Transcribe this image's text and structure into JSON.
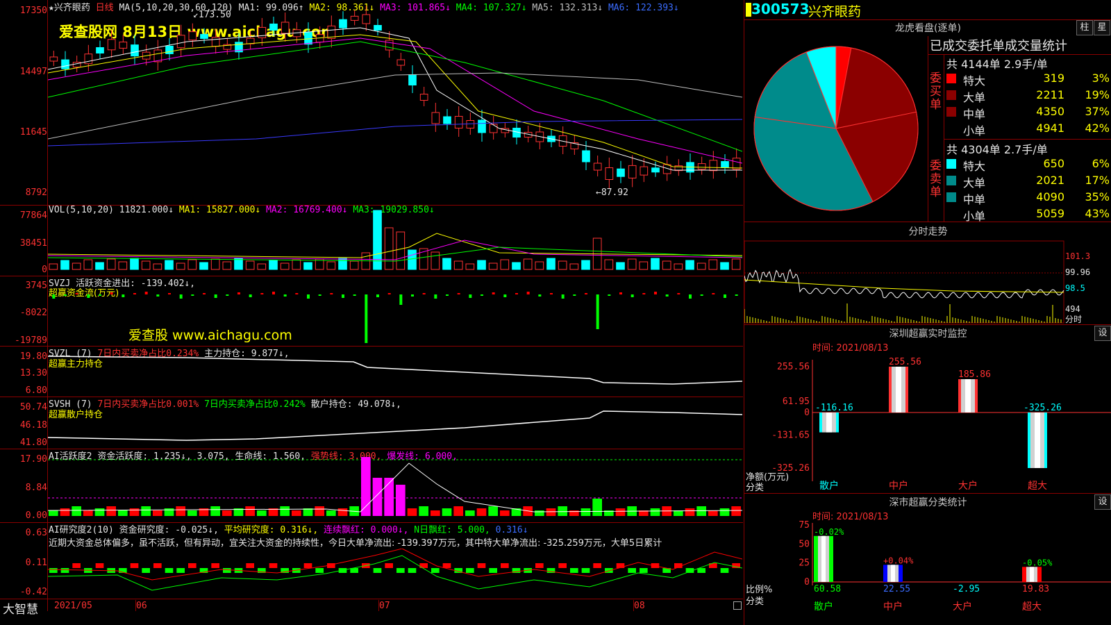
{
  "main_chart": {
    "title_star": "★",
    "stock_name": "兴齐眼药",
    "period": "日线",
    "ma_label": "MA(5,10,20,30,60,120)",
    "ma1": "MA1: 99.096↑",
    "ma2": "MA2: 98.361↓",
    "ma3": "MA3: 101.865↓",
    "ma4": "MA4: 107.327↓",
    "ma5": "MA5: 132.313↓",
    "ma6": "MA6: 122.393↓",
    "y_ticks": [
      "17350",
      "14497",
      "11645",
      "8792"
    ],
    "high_label": "173.50",
    "low_label": "87.92",
    "watermark": "爱查股网  8月13日 www.aichagu.com"
  },
  "vol_panel": {
    "title": "VOL(5,10,20)",
    "vol": "11821.000↓",
    "ma1": "MA1: 15827.000↓",
    "ma2": "MA2: 16769.400↓",
    "ma3": "MA3: 19029.850↓",
    "y_ticks": [
      "77864",
      "38451",
      "0"
    ]
  },
  "svzj_panel": {
    "title": "SVZJ",
    "value": "活跃资金进出: -139.402↓,",
    "subtitle": "超赢资金流(万元)",
    "y_ticks": [
      "3745",
      "-8022",
      "-19789"
    ],
    "watermark": "爱查股 www.aichagu.com"
  },
  "svzl_panel": {
    "title": "SVZL (7)",
    "ratio": "7日内买卖净占比0.234%",
    "value": "主力持仓: 9.877↓,",
    "subtitle": "超赢主力持仓",
    "y_ticks": [
      "19.80",
      "13.30",
      "6.80"
    ]
  },
  "svsh_panel": {
    "title": "SVSH (7)",
    "ratio1": "7日内买卖净占比0.001%",
    "ratio2": "7日内买卖净占比0.242%",
    "value": "散户持仓: 49.078↓,",
    "subtitle": "超赢散户持仓",
    "y_ticks": [
      "50.74",
      "46.18",
      "41.80"
    ]
  },
  "ai_panel": {
    "title": "AI活跃度2",
    "v1": "资金活跃度: 1.235↓,",
    "v2": "3.075,",
    "v3": "生命线: 1.560,",
    "v4": "强势线: 3.000,",
    "v5": "爆发线: 6.000,",
    "y_ticks": [
      "17.90",
      "8.84",
      "0.00"
    ]
  },
  "ai_research": {
    "title": "AI研究度2(10)",
    "v1": "资金研究度: -0.025↓,",
    "v2": "平均研究度: 0.316↓,",
    "v3": "连续飘红: 0.000↓,",
    "v4": "N日飘红: 5.000,",
    "v5": "0.316↓",
    "comment": "近期大资金总体偏多，虽不活跃，但有异动，宜关注大资金的持续性，今日大单净流出: -139.397万元，其中特大单净流出: -325.259万元，大单5日累计",
    "y_ticks": [
      "0.63",
      "0.11",
      "-0.42"
    ]
  },
  "x_axis": {
    "brand": "大智慧",
    "labels": [
      "2021/05",
      "06",
      "07",
      "08"
    ]
  },
  "right": {
    "code": "300573",
    "name": "兴齐眼药",
    "lhb_title": "龙虎看盘(逐单)",
    "btn_zhu": "柱",
    "btn_xing": "星",
    "stats_title": "已成交委托单成交量统计",
    "buy_side": "委买单",
    "sell_side": "委卖单",
    "buy_summary": "共 4144单 2.9手/单",
    "sell_summary": "共 4304单 2.7手/单",
    "buy_rows": [
      {
        "label": "特大",
        "count": "319",
        "pct": "3%",
        "color": "#ff0000"
      },
      {
        "label": "大单",
        "count": "2211",
        "pct": "19%",
        "color": "#8b0000"
      },
      {
        "label": "中单",
        "count": "4350",
        "pct": "37%",
        "color": "#8b0000"
      },
      {
        "label": "小单",
        "count": "4941",
        "pct": "42%",
        "color": ""
      }
    ],
    "sell_rows": [
      {
        "label": "特大",
        "count": "650",
        "pct": "6%",
        "color": "#00ffff"
      },
      {
        "label": "大单",
        "count": "2021",
        "pct": "17%",
        "color": "#008b8b"
      },
      {
        "label": "中单",
        "count": "4090",
        "pct": "35%",
        "color": "#008b8b"
      },
      {
        "label": "小单",
        "count": "5059",
        "pct": "43%",
        "color": ""
      }
    ],
    "intraday_title": "分时走势",
    "intraday_ticks": [
      "101.3",
      "99.96",
      "98.5",
      "494",
      "分时"
    ],
    "monitor_title": "深圳超赢实时监控",
    "monitor_btn": "设",
    "monitor_time": "时间: 2021/08/13",
    "monitor_y": [
      "255.56",
      "61.95",
      "0",
      "-131.65",
      "-325.26"
    ],
    "monitor_ylabel": "净额(万元)",
    "monitor_xlabel": "分类",
    "monitor_bars": [
      {
        "cat": "散户",
        "value": -116.16,
        "label": "-116.16"
      },
      {
        "cat": "中户",
        "value": 255.56,
        "label": "255.56"
      },
      {
        "cat": "大户",
        "value": 185.86,
        "label": "185.86"
      },
      {
        "cat": "超大",
        "value": -325.26,
        "label": "-325.26"
      }
    ],
    "class_title": "深市超赢分类统计",
    "class_btn": "设",
    "class_time": "时间: 2021/08/13",
    "class_y": [
      "75",
      "50",
      "25",
      "0"
    ],
    "class_ylabel": "比例%",
    "class_xlabel": "分类",
    "class_bars": [
      {
        "cat": "散户",
        "value": 60.58,
        "label": "60.58",
        "delta": "-0.02%"
      },
      {
        "cat": "中户",
        "value": 22.55,
        "label": "22.55",
        "delta": "+0.04%"
      },
      {
        "cat": "大户",
        "value": -2.95,
        "label": "-2.95",
        "delta": ""
      },
      {
        "cat": "超大",
        "value": 19.83,
        "label": "19.83",
        "delta": "-0.05%"
      }
    ]
  },
  "chart_data": {
    "type": "candlestick",
    "pie": {
      "type": "pie",
      "slices": [
        {
          "name": "买特大",
          "value": 3,
          "color": "#ff0000"
        },
        {
          "name": "买大单",
          "value": 19,
          "color": "#8b0000"
        },
        {
          "name": "买中单",
          "value": 37,
          "color": "#8b0000"
        },
        {
          "name": "买小单",
          "value": 42,
          "color": "#000000"
        }
      ]
    }
  }
}
